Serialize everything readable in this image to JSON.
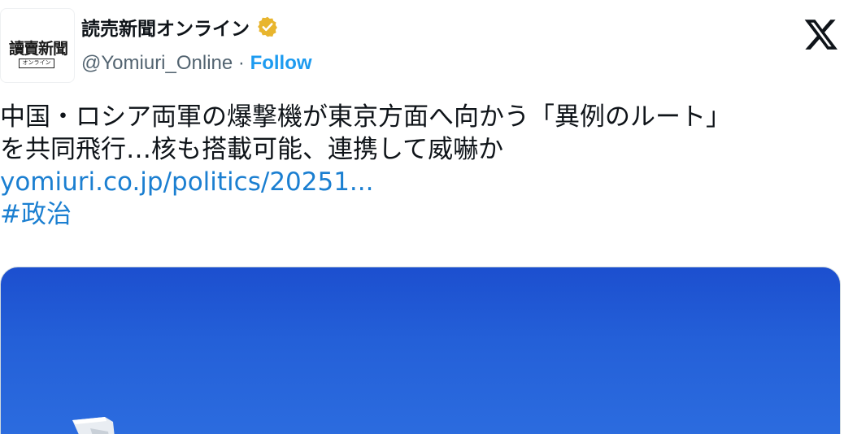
{
  "account": {
    "avatar_main": "讀賣新聞",
    "avatar_sub": "オンライン",
    "display_name": "読売新聞オンライン",
    "handle": "@Yomiuri_Online",
    "separator": " · ",
    "follow_label": "Follow"
  },
  "tweet": {
    "line1": "中国・ロシア両軍の爆撃機が東京方面へ向かう「異例のルート」",
    "line2": "を共同飛行…核も搭載可能、連携して威嚇か",
    "link": "yomiuri.co.jp/politics/20251...",
    "hashtag": "#政治"
  },
  "icons": {
    "verified": "verified-badge-icon",
    "x_logo": "x-logo-icon"
  },
  "colors": {
    "link": "#1b7fd1",
    "follow": "#1d9bf0",
    "verified": "#e8b52e",
    "sky": "#2460d8"
  }
}
